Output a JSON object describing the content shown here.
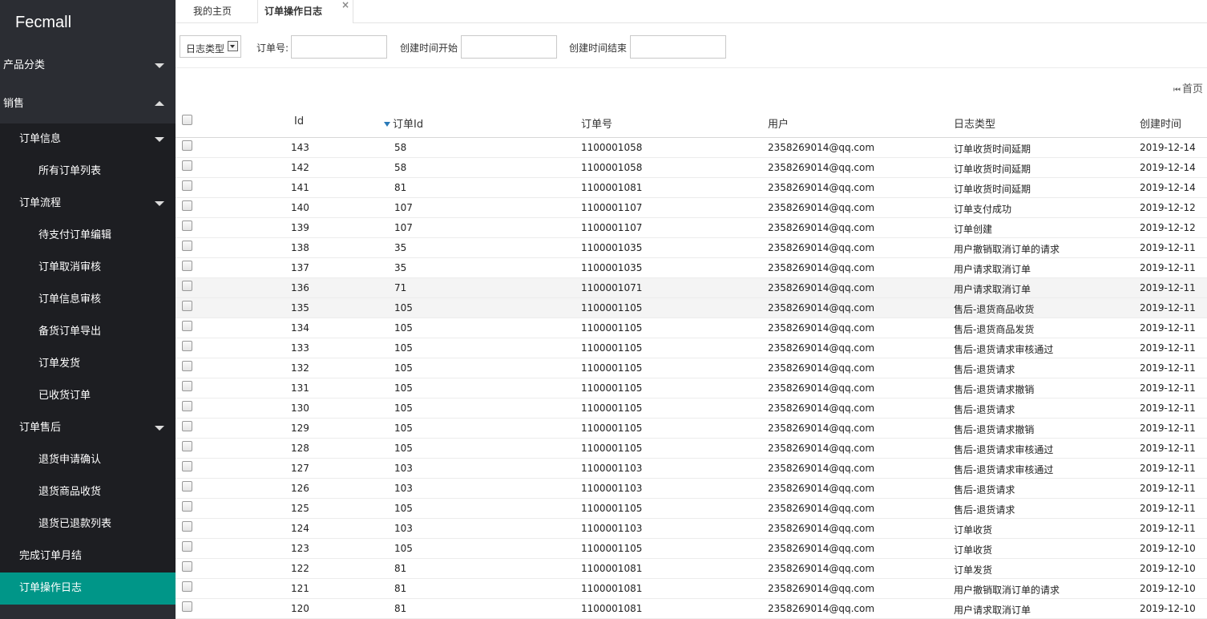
{
  "brand": "Fecmall",
  "sidebar": {
    "product_category": "产品分类",
    "sales": "销售",
    "order_info": {
      "label": "订单信息",
      "items": [
        "所有订单列表"
      ]
    },
    "order_flow": {
      "label": "订单流程",
      "items": [
        "待支付订单编辑",
        "订单取消审核",
        "订单信息审核",
        "备货订单导出",
        "订单发货",
        "已收货订单"
      ]
    },
    "after_sales": {
      "label": "订单售后",
      "items": [
        "退货申请确认",
        "退货商品收货",
        "退货已退款列表"
      ]
    },
    "monthly": "完成订单月结",
    "op_log": "订单操作日志"
  },
  "tabs": {
    "home": "我的主页",
    "current": "订单操作日志",
    "close_glyph": "×"
  },
  "filters": {
    "log_type_label": "日志类型",
    "order_no_label": "订单号:",
    "created_start_label": "创建时间开始",
    "created_end_label": "创建时间结束"
  },
  "pager": {
    "first_page": "首页"
  },
  "table": {
    "headers": {
      "id": "Id",
      "order_id": "订单Id",
      "order_no": "订单号",
      "user": "用户",
      "log_type": "日志类型",
      "created_at": "创建时间"
    },
    "rows": [
      {
        "id": "143",
        "order_id": "58",
        "order_no": "1100001058",
        "user": "2358269014@qq.com",
        "log_type": "订单收货时间延期",
        "created_at": "2019-12-14"
      },
      {
        "id": "142",
        "order_id": "58",
        "order_no": "1100001058",
        "user": "2358269014@qq.com",
        "log_type": "订单收货时间延期",
        "created_at": "2019-12-14"
      },
      {
        "id": "141",
        "order_id": "81",
        "order_no": "1100001081",
        "user": "2358269014@qq.com",
        "log_type": "订单收货时间延期",
        "created_at": "2019-12-14"
      },
      {
        "id": "140",
        "order_id": "107",
        "order_no": "1100001107",
        "user": "2358269014@qq.com",
        "log_type": "订单支付成功",
        "created_at": "2019-12-12"
      },
      {
        "id": "139",
        "order_id": "107",
        "order_no": "1100001107",
        "user": "2358269014@qq.com",
        "log_type": "订单创建",
        "created_at": "2019-12-12"
      },
      {
        "id": "138",
        "order_id": "35",
        "order_no": "1100001035",
        "user": "2358269014@qq.com",
        "log_type": "用户撤销取消订单的请求",
        "created_at": "2019-12-11"
      },
      {
        "id": "137",
        "order_id": "35",
        "order_no": "1100001035",
        "user": "2358269014@qq.com",
        "log_type": "用户请求取消订单",
        "created_at": "2019-12-11"
      },
      {
        "id": "136",
        "order_id": "71",
        "order_no": "1100001071",
        "user": "2358269014@qq.com",
        "log_type": "用户请求取消订单",
        "created_at": "2019-12-11"
      },
      {
        "id": "135",
        "order_id": "105",
        "order_no": "1100001105",
        "user": "2358269014@qq.com",
        "log_type": "售后-退货商品收货",
        "created_at": "2019-12-11"
      },
      {
        "id": "134",
        "order_id": "105",
        "order_no": "1100001105",
        "user": "2358269014@qq.com",
        "log_type": "售后-退货商品发货",
        "created_at": "2019-12-11"
      },
      {
        "id": "133",
        "order_id": "105",
        "order_no": "1100001105",
        "user": "2358269014@qq.com",
        "log_type": "售后-退货请求审核通过",
        "created_at": "2019-12-11"
      },
      {
        "id": "132",
        "order_id": "105",
        "order_no": "1100001105",
        "user": "2358269014@qq.com",
        "log_type": "售后-退货请求",
        "created_at": "2019-12-11"
      },
      {
        "id": "131",
        "order_id": "105",
        "order_no": "1100001105",
        "user": "2358269014@qq.com",
        "log_type": "售后-退货请求撤销",
        "created_at": "2019-12-11"
      },
      {
        "id": "130",
        "order_id": "105",
        "order_no": "1100001105",
        "user": "2358269014@qq.com",
        "log_type": "售后-退货请求",
        "created_at": "2019-12-11"
      },
      {
        "id": "129",
        "order_id": "105",
        "order_no": "1100001105",
        "user": "2358269014@qq.com",
        "log_type": "售后-退货请求撤销",
        "created_at": "2019-12-11"
      },
      {
        "id": "128",
        "order_id": "105",
        "order_no": "1100001105",
        "user": "2358269014@qq.com",
        "log_type": "售后-退货请求审核通过",
        "created_at": "2019-12-11"
      },
      {
        "id": "127",
        "order_id": "103",
        "order_no": "1100001103",
        "user": "2358269014@qq.com",
        "log_type": "售后-退货请求审核通过",
        "created_at": "2019-12-11"
      },
      {
        "id": "126",
        "order_id": "103",
        "order_no": "1100001103",
        "user": "2358269014@qq.com",
        "log_type": "售后-退货请求",
        "created_at": "2019-12-11"
      },
      {
        "id": "125",
        "order_id": "105",
        "order_no": "1100001105",
        "user": "2358269014@qq.com",
        "log_type": "售后-退货请求",
        "created_at": "2019-12-11"
      },
      {
        "id": "124",
        "order_id": "103",
        "order_no": "1100001103",
        "user": "2358269014@qq.com",
        "log_type": "订单收货",
        "created_at": "2019-12-11"
      },
      {
        "id": "123",
        "order_id": "105",
        "order_no": "1100001105",
        "user": "2358269014@qq.com",
        "log_type": "订单收货",
        "created_at": "2019-12-10"
      },
      {
        "id": "122",
        "order_id": "81",
        "order_no": "1100001081",
        "user": "2358269014@qq.com",
        "log_type": "订单发货",
        "created_at": "2019-12-10"
      },
      {
        "id": "121",
        "order_id": "81",
        "order_no": "1100001081",
        "user": "2358269014@qq.com",
        "log_type": "用户撤销取消订单的请求",
        "created_at": "2019-12-10"
      },
      {
        "id": "120",
        "order_id": "81",
        "order_no": "1100001081",
        "user": "2358269014@qq.com",
        "log_type": "用户请求取消订单",
        "created_at": "2019-12-10"
      }
    ]
  },
  "colors": {
    "sidebar_bg": "#2b2d33",
    "submenu_bg": "#1d1e22",
    "active_bg": "#009688",
    "sort_indicator": "#2a7ab8"
  }
}
